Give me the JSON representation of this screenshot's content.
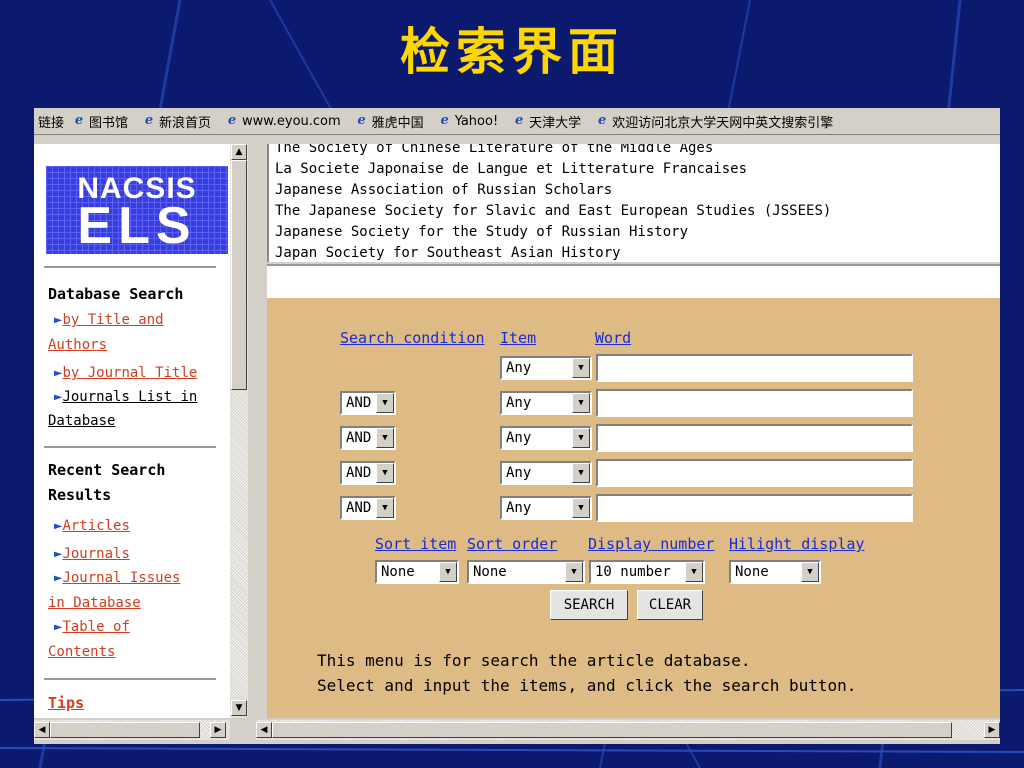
{
  "slide": {
    "title": "检索界面"
  },
  "linkbar": {
    "label": "链接",
    "links": [
      "图书馆",
      "新浪首页",
      "www.eyou.com",
      "雅虎中国",
      "Yahoo!",
      "天津大学",
      "欢迎访问北京大学天网中英文搜索引擎"
    ]
  },
  "logo": {
    "line1": "NACSIS",
    "line2": "ELS"
  },
  "sidebar": {
    "database_search": "Database Search",
    "by_title_authors_1": "by Title and",
    "by_title_authors_2": "Authors",
    "by_journal_title": "by Journal Title",
    "journals_list_1": "Journals List in",
    "journals_list_2": "Database",
    "recent_1": "Recent Search",
    "recent_2": "Results",
    "articles": "Articles",
    "journals": "Journals",
    "journal_issues_1": "Journal Issues",
    "journal_issues_2": "in Database",
    "toc_1": "Table of",
    "toc_2": "Contents",
    "tips": "Tips"
  },
  "society_list": [
    "The Society of Chinese Literature of the Middle Ages",
    "La Societe Japonaise de Langue et Litterature Francaises",
    "Japanese Association of Russian Scholars",
    "The Japanese Society for Slavic and East European Studies (JSSEES)",
    "Japanese Society for the Study of Russian History",
    "Japan Society for Southeast Asian History"
  ],
  "search": {
    "col_condition": "Search condition",
    "col_item": "Item",
    "col_word": "Word",
    "rows": [
      {
        "condition": "",
        "item": "Any"
      },
      {
        "condition": "AND",
        "item": "Any"
      },
      {
        "condition": "AND",
        "item": "Any"
      },
      {
        "condition": "AND",
        "item": "Any"
      },
      {
        "condition": "AND",
        "item": "Any"
      }
    ],
    "sort_item_label": "Sort item",
    "sort_order_label": "Sort order",
    "display_number_label": "Display number",
    "hilight_label": "Hilight display",
    "sort_item_value": "None",
    "sort_order_value": "None",
    "display_number_value": "10 number",
    "hilight_value": "None",
    "search_button": "SEARCH",
    "clear_button": "CLEAR",
    "help_line1": "This menu is for search the article database.",
    "help_line2": "Select and input the items, and click the search button."
  }
}
